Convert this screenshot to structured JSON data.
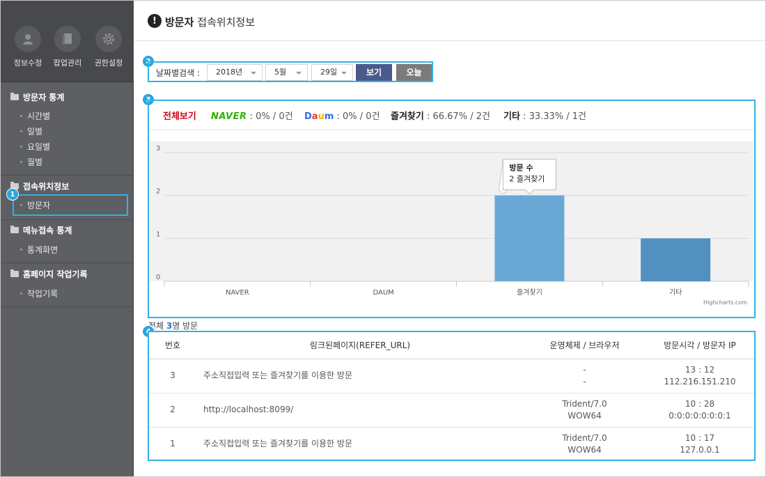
{
  "sidebar": {
    "tools": [
      {
        "label": "정보수정",
        "icon": "user-icon"
      },
      {
        "label": "팝업관리",
        "icon": "book-icon"
      },
      {
        "label": "권한설정",
        "icon": "gear-icon"
      }
    ],
    "sections": [
      {
        "title": "방문자 통계",
        "items": [
          "시간별",
          "일별",
          "요일별",
          "월별"
        ]
      },
      {
        "title": "접속위치정보",
        "items": [
          "방문자"
        ]
      },
      {
        "title": "메뉴접속 통계",
        "items": [
          "통계화면"
        ]
      },
      {
        "title": "홈페이지 작업기록",
        "items": [
          "작업기록"
        ]
      }
    ]
  },
  "header": {
    "title_bold": "방문자",
    "title_rest": "접속위치정보",
    "icon": "exclamation-icon"
  },
  "badges": [
    "1",
    "2",
    "3",
    "4"
  ],
  "date_search": {
    "label": "날짜별검색 :",
    "year": "2018년",
    "month": "5월",
    "day": "29일",
    "view_button": "보기",
    "today_button": "오늘"
  },
  "stats": {
    "all": "전체보기",
    "naver_brand": "NAVER",
    "naver_value": " : 0% / 0건",
    "daum_brand": "Daum",
    "daum_value": " : 0% / 0건",
    "bookmark_label": "즐겨찾기",
    "bookmark_value": " : 66.67% / 2건",
    "other_label": "기타",
    "other_value": " : 33.33% / 1건"
  },
  "chart_data": {
    "type": "bar",
    "categories": [
      "NAVER",
      "DAUM",
      "즐겨찾기",
      "기타"
    ],
    "values": [
      0,
      0,
      2,
      1
    ],
    "ylim": [
      0,
      3
    ],
    "yticks": [
      "0",
      "1",
      "2",
      "3"
    ],
    "grid": true,
    "colors": [
      "#6aa8d6",
      "#6aa8d6",
      "#6aa8d6",
      "#5290c0"
    ],
    "tooltip": {
      "title": "방문 수",
      "line": "2 즐겨찾기"
    },
    "credit": "Highcharts.com"
  },
  "summary": {
    "prefix": "전체 ",
    "count": "3",
    "suffix": "명 방문"
  },
  "table": {
    "headers": [
      "번호",
      "링크된페이지(REFER_URL)",
      "운영체제 / 브라우저",
      "방문시각 / 방문자 IP"
    ],
    "rows": [
      {
        "no": "3",
        "url": "주소직접입력 또는 즐겨찾기를 이용한 방문",
        "os": "-",
        "browser": "-",
        "time": "13 : 12",
        "ip": "112.216.151.210"
      },
      {
        "no": "2",
        "url": "http://localhost:8099/",
        "os": "Trident/7.0",
        "browser": "WOW64",
        "time": "10 : 28",
        "ip": "0:0:0:0:0:0:0:1"
      },
      {
        "no": "1",
        "url": "주소직접입력 또는 즐겨찾기를 이용한 방문",
        "os": "Trident/7.0",
        "browser": "WOW64",
        "time": "10 : 17",
        "ip": "127.0.0.1"
      }
    ]
  }
}
